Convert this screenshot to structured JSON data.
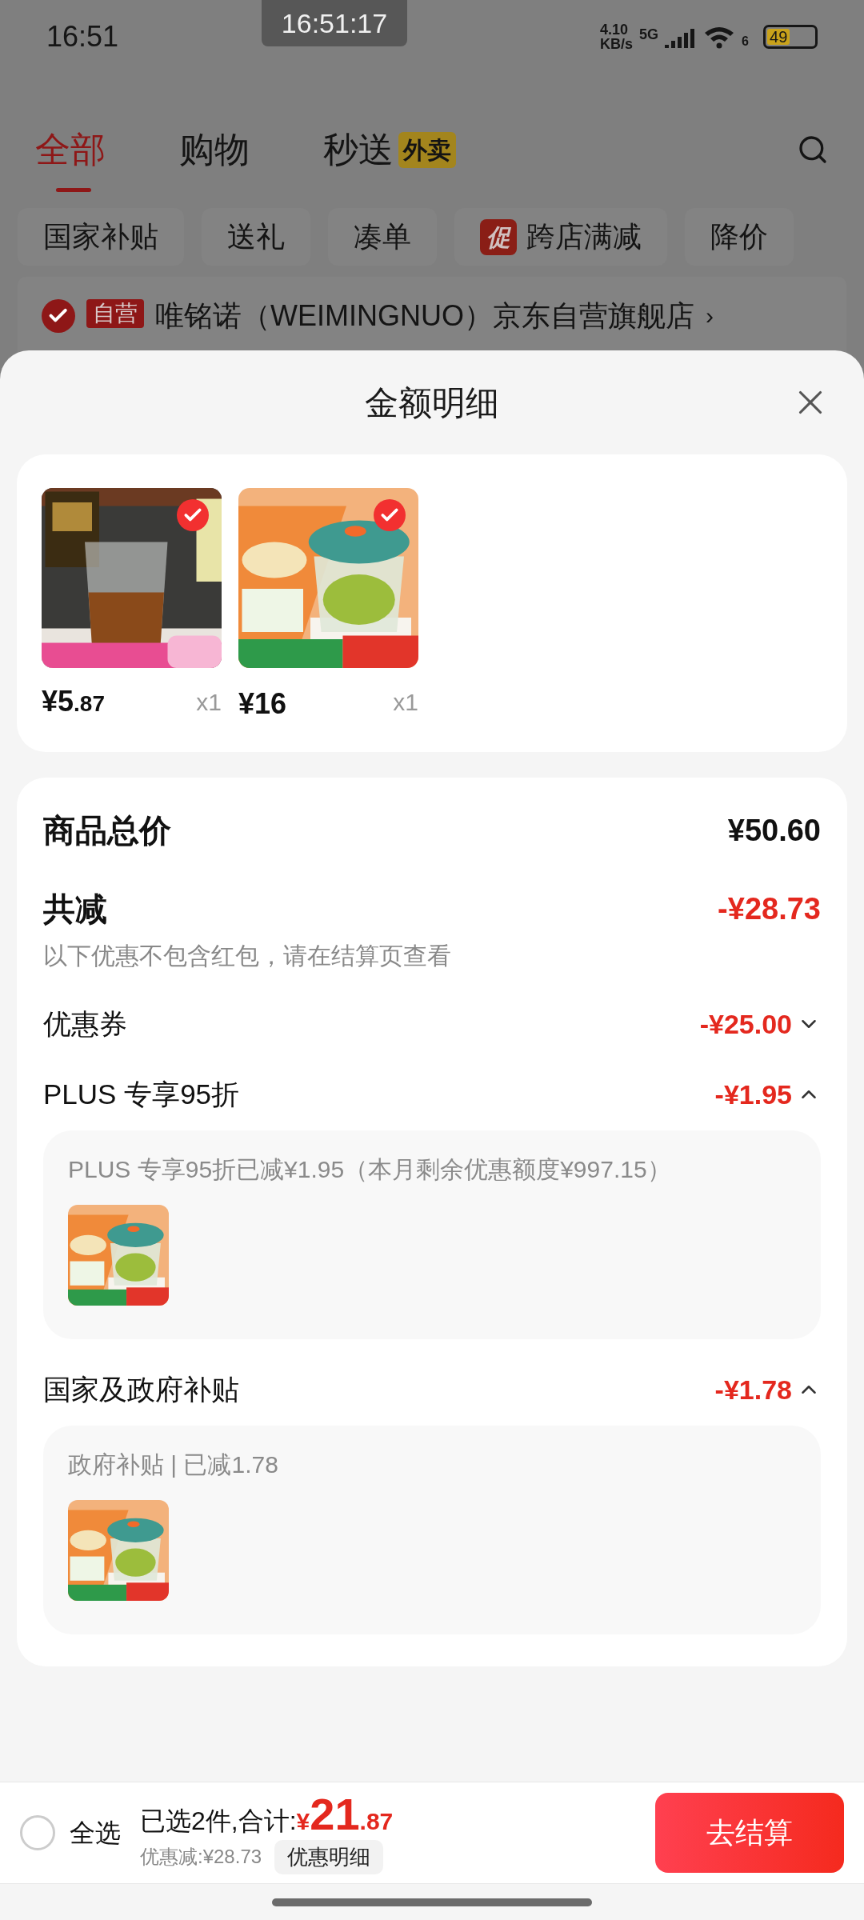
{
  "status_bar": {
    "time": "16:51",
    "clock_overlay": "16:51:17",
    "net_speed": "4.10",
    "net_unit": "KB/s",
    "network": "5G",
    "wifi_label": "6",
    "battery": "49"
  },
  "tabs": [
    {
      "label": "全部",
      "selected": true
    },
    {
      "label": "购物",
      "selected": false
    },
    {
      "label": "秒送",
      "badge": "外卖",
      "selected": false
    }
  ],
  "filter_chips": [
    {
      "label": "国家补贴"
    },
    {
      "label": "送礼"
    },
    {
      "label": "凑单"
    },
    {
      "label": "跨店满减",
      "tag": "促"
    },
    {
      "label": "降价"
    }
  ],
  "store": {
    "checked": true,
    "tag": "自营",
    "name": "唯铭诺（WEIMINGNUO）京东自营旗舰店",
    "chevron": "›"
  },
  "sheet": {
    "title": "金额明细",
    "products": [
      {
        "kind": "glass",
        "price_main": "¥5",
        "price_decimal": ".87",
        "quantity": "x1",
        "checked": true
      },
      {
        "kind": "chopper",
        "price_main": "¥16",
        "quantity": "x1",
        "checked": true
      }
    ],
    "summary": {
      "total_label": "商品总价",
      "total": "¥50.60",
      "reduction_label": "共减",
      "reduction": "-¥28.73",
      "note": "以下优惠不包含红包，请在结算页查看"
    },
    "discounts": [
      {
        "label": "优惠券",
        "amount": "-¥25.00",
        "expanded": false
      },
      {
        "label": "PLUS 专享95折",
        "amount": "-¥1.95",
        "expanded": true,
        "detail": "PLUS 专享95折已减¥1.95（本月剩余优惠额度¥997.15）"
      },
      {
        "label": "国家及政府补贴",
        "amount": "-¥1.78",
        "expanded": true,
        "detail": "政府补贴 | 已减1.78"
      }
    ]
  },
  "footer": {
    "select_all_label": "全选",
    "select_all_checked": false,
    "selected_text": "已选2件,合计:",
    "total_currency": "¥",
    "total_int": "21",
    "total_decimal": ".87",
    "saved": "优惠减:¥28.73",
    "details_button": "优惠明细",
    "checkout_button": "去结算"
  }
}
